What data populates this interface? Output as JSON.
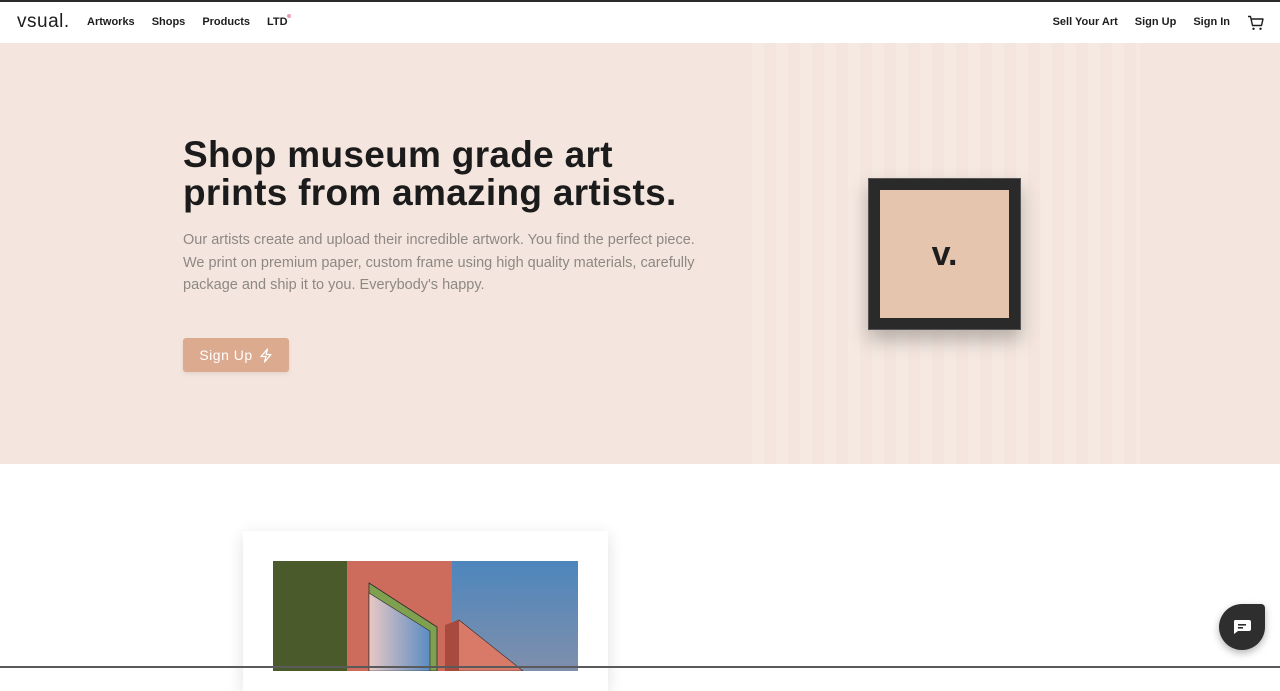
{
  "nav": {
    "logo": "vsual.",
    "left_links": [
      "Artworks",
      "Shops",
      "Products",
      "LTD"
    ],
    "right_links": [
      "Sell Your Art",
      "Sign Up",
      "Sign In"
    ],
    "cart_icon": "cart-icon"
  },
  "hero": {
    "headline_line1": "Shop museum grade art",
    "headline_line2": "prints from amazing artists.",
    "subtext": "Our artists create and upload their incredible artwork. You find the perfect piece. We print on premium paper, custom frame using high quality materials, carefully package and ship it to you. Everybody's happy.",
    "cta_label": "Sign Up",
    "cta_icon": "lightning-icon",
    "frame_text": "v.",
    "accent_color": "#dcaa8f",
    "background_color": "#f4e6de"
  },
  "chat": {
    "icon": "chat-icon"
  }
}
